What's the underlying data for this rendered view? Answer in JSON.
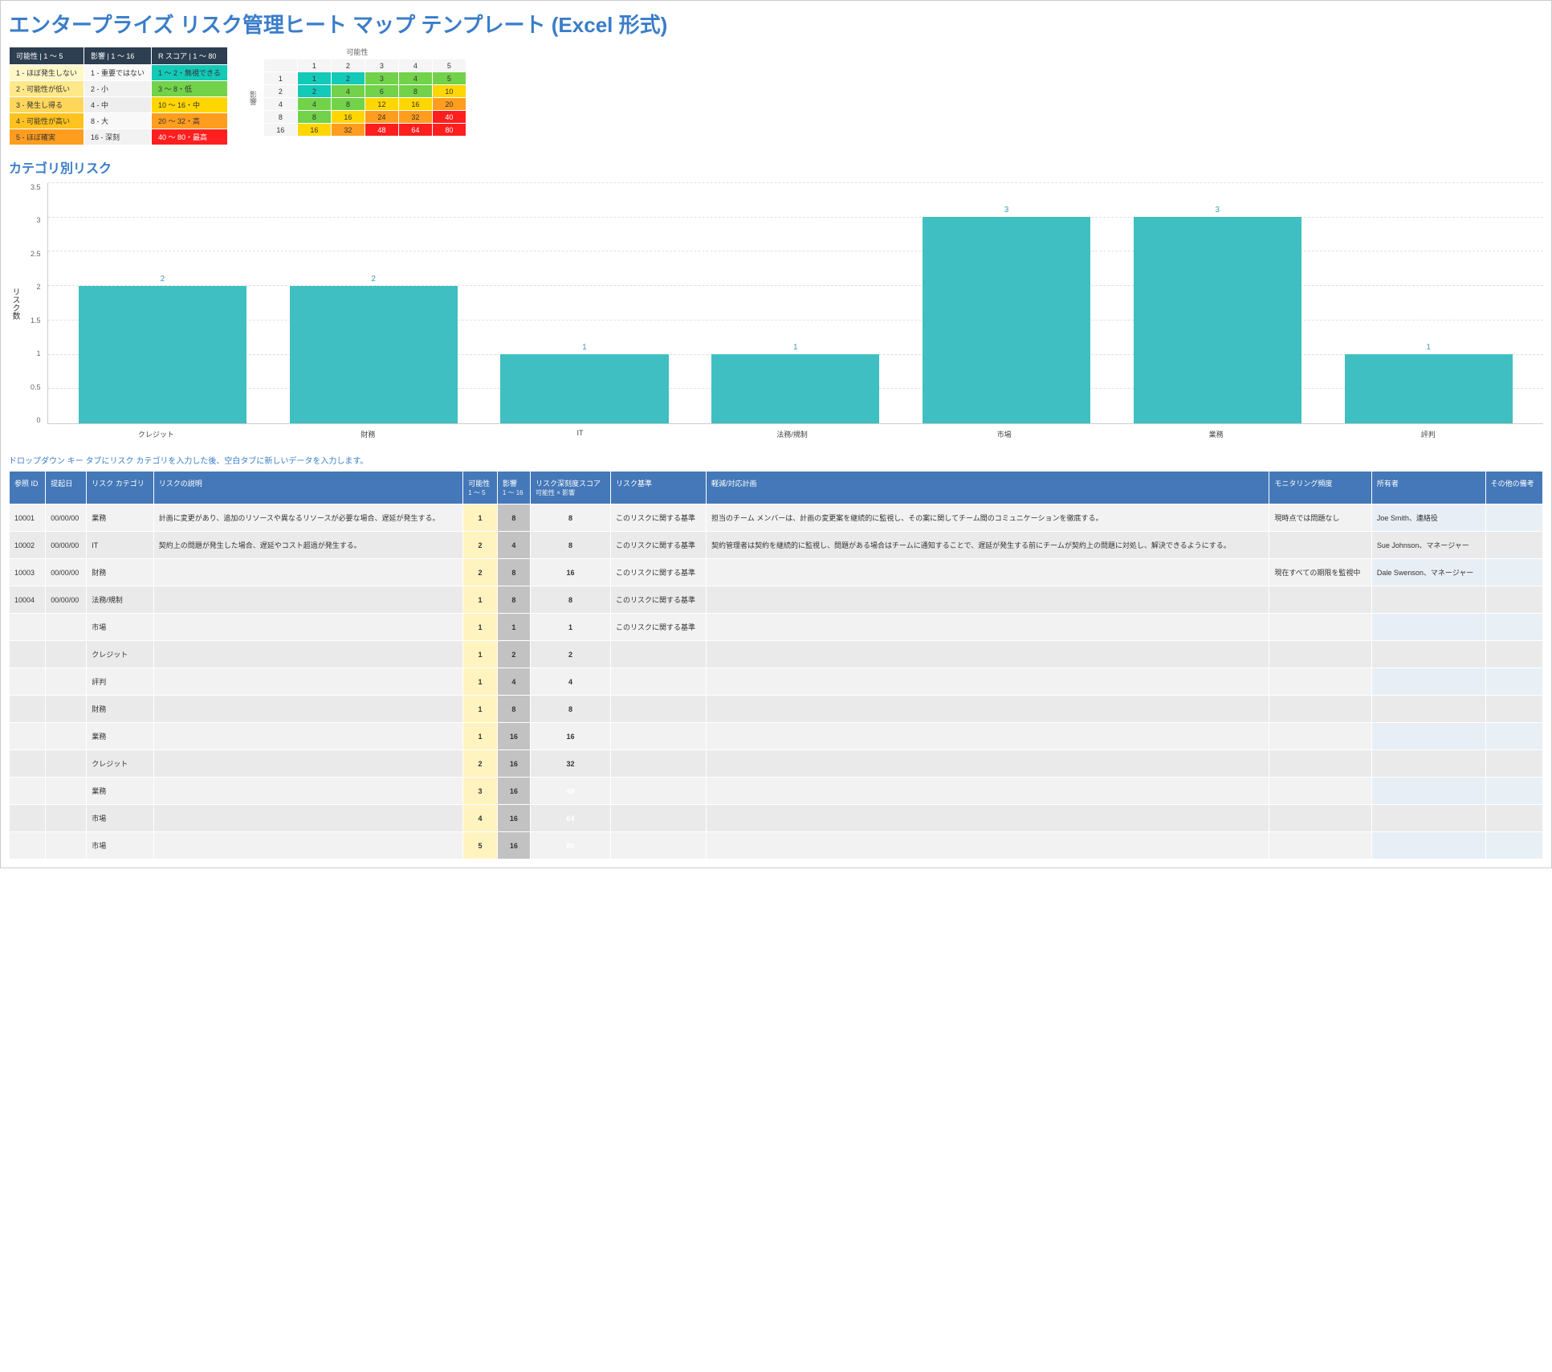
{
  "title": "エンタープライズ リスク管理ヒート マップ テンプレート (Excel 形式)",
  "legend": {
    "headers": [
      "可能性 | 1 ～ 5",
      "影響 | 1 ～ 16",
      "R スコア | 1 ～ 80"
    ],
    "rows": [
      {
        "p": "1 - ほぼ発生しない",
        "i": "1 - 重要ではない",
        "s": "1 ～ 2・無視できる"
      },
      {
        "p": "2 - 可能性が低い",
        "i": "2 - 小",
        "s": "3 ～ 8・低"
      },
      {
        "p": "3 - 発生し得る",
        "i": "4 - 中",
        "s": "10 ～ 16・中"
      },
      {
        "p": "4 - 可能性が高い",
        "i": "8 - 大",
        "s": "20 ～ 32・高"
      },
      {
        "p": "5 - ほぼ確実",
        "i": "16 - 深刻",
        "s": "40 ～ 80・最高"
      }
    ]
  },
  "heatmap": {
    "xlabel": "可能性",
    "ylabel": "影響",
    "cols": [
      "1",
      "2",
      "3",
      "4",
      "5"
    ],
    "rows": [
      "1",
      "2",
      "4",
      "8",
      "16"
    ],
    "cells": [
      [
        "1",
        "2",
        "3",
        "4",
        "5"
      ],
      [
        "2",
        "4",
        "6",
        "8",
        "10"
      ],
      [
        "4",
        "8",
        "12",
        "16",
        "20"
      ],
      [
        "8",
        "16",
        "24",
        "32",
        "40"
      ],
      [
        "16",
        "32",
        "48",
        "64",
        "80"
      ]
    ]
  },
  "chart_title": "カテゴリ別リスク",
  "chart_data": {
    "type": "bar",
    "categories": [
      "クレジット",
      "財務",
      "IT",
      "法務/規制",
      "市場",
      "業務",
      "評判"
    ],
    "values": [
      2,
      2,
      1,
      1,
      3,
      3,
      1
    ],
    "ylabel": "リスク数",
    "ylim": [
      0,
      3.5
    ],
    "yticks": [
      0,
      0.5,
      1,
      1.5,
      2,
      2.5,
      3,
      3.5
    ],
    "color": "#3fbfc1"
  },
  "note": "ドロップダウン キー タブにリスク カテゴリを入力した後、空白タブに新しいデータを入力します。",
  "risk_headers": {
    "ref": "参照 ID",
    "date": "提起日",
    "cat": "リスク カテゴリ",
    "desc": "リスクの説明",
    "prob": "可能性",
    "prob_sub": "1 ～ 5",
    "imp": "影響",
    "imp_sub": "1 ～ 16",
    "score": "リスク深刻度スコア",
    "score_sub": "可能性 × 影響",
    "basis": "リスク基準",
    "mit": "軽減/対応計画",
    "mon": "モニタリング頻度",
    "owner": "所有者",
    "other": "その他の備考"
  },
  "risks": [
    {
      "ref": "10001",
      "date": "00/00/00",
      "cat": "業務",
      "desc": "計画に変更があり、追加のリソースや異なるリソースが必要な場合、遅延が発生する。",
      "prob": "1",
      "imp": "8",
      "score": "8",
      "sc": "cC",
      "basis": "このリスクに関する基準",
      "mit": "担当のチーム メンバーは、計画の変更案を継続的に監視し、その案に関してチーム間のコミュニケーションを徹底する。",
      "mon": "現時点では問題なし",
      "owner": "Joe Smith、連絡役"
    },
    {
      "ref": "10002",
      "date": "00/00/00",
      "cat": "IT",
      "desc": "契約上の問題が発生した場合、遅延やコスト超過が発生する。",
      "prob": "2",
      "imp": "4",
      "score": "8",
      "sc": "cC",
      "basis": "このリスクに関する基準",
      "mit": "契約管理者は契約を継続的に監視し、問題がある場合はチームに通知することで、遅延が発生する前にチームが契約上の問題に対処し、解決できるようにする。",
      "mon": "",
      "owner": "Sue Johnson、マネージャー"
    },
    {
      "ref": "10003",
      "date": "00/00/00",
      "cat": "財務",
      "desc": "",
      "prob": "2",
      "imp": "8",
      "score": "16",
      "sc": "cD",
      "basis": "このリスクに関する基準",
      "mit": "",
      "mon": "現在すべての期限を監視中",
      "owner": "Dale Swenson、マネージャー"
    },
    {
      "ref": "10004",
      "date": "00/00/00",
      "cat": "法務/規制",
      "desc": "",
      "prob": "1",
      "imp": "8",
      "score": "8",
      "sc": "cC",
      "basis": "このリスクに関する基準",
      "mit": "",
      "mon": "",
      "owner": ""
    },
    {
      "ref": "",
      "date": "",
      "cat": "市場",
      "desc": "",
      "prob": "1",
      "imp": "1",
      "score": "1",
      "sc": "cA",
      "basis": "このリスクに関する基準",
      "mit": "",
      "mon": "",
      "owner": ""
    },
    {
      "ref": "",
      "date": "",
      "cat": "クレジット",
      "desc": "",
      "prob": "1",
      "imp": "2",
      "score": "2",
      "sc": "cA",
      "basis": "",
      "mit": "",
      "mon": "",
      "owner": ""
    },
    {
      "ref": "",
      "date": "",
      "cat": "評判",
      "desc": "",
      "prob": "1",
      "imp": "4",
      "score": "4",
      "sc": "cB",
      "basis": "",
      "mit": "",
      "mon": "",
      "owner": ""
    },
    {
      "ref": "",
      "date": "",
      "cat": "財務",
      "desc": "",
      "prob": "1",
      "imp": "8",
      "score": "8",
      "sc": "cC",
      "basis": "",
      "mit": "",
      "mon": "",
      "owner": ""
    },
    {
      "ref": "",
      "date": "",
      "cat": "業務",
      "desc": "",
      "prob": "1",
      "imp": "16",
      "score": "16",
      "sc": "cD",
      "basis": "",
      "mit": "",
      "mon": "",
      "owner": ""
    },
    {
      "ref": "",
      "date": "",
      "cat": "クレジット",
      "desc": "",
      "prob": "2",
      "imp": "16",
      "score": "32",
      "sc": "cE",
      "basis": "",
      "mit": "",
      "mon": "",
      "owner": ""
    },
    {
      "ref": "",
      "date": "",
      "cat": "業務",
      "desc": "",
      "prob": "3",
      "imp": "16",
      "score": "48",
      "sc": "cF",
      "basis": "",
      "mit": "",
      "mon": "",
      "owner": ""
    },
    {
      "ref": "",
      "date": "",
      "cat": "市場",
      "desc": "",
      "prob": "4",
      "imp": "16",
      "score": "64",
      "sc": "cF",
      "basis": "",
      "mit": "",
      "mon": "",
      "owner": ""
    },
    {
      "ref": "",
      "date": "",
      "cat": "市場",
      "desc": "",
      "prob": "5",
      "imp": "16",
      "score": "80",
      "sc": "cF",
      "basis": "",
      "mit": "",
      "mon": "",
      "owner": ""
    }
  ]
}
